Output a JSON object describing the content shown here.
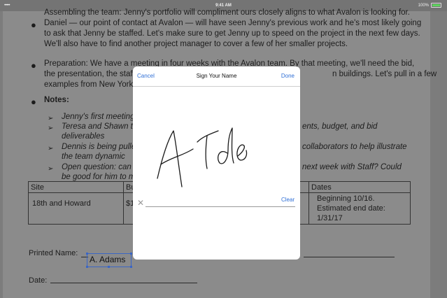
{
  "status_bar": {
    "signal": "•••••",
    "time": "9:41 AM",
    "battery": "100%"
  },
  "document": {
    "paragraph1": [
      "Assembling the team: Jenny's portfolio will compliment ours closely aligns to what Avalon is looking for.",
      "Daniel — our point of contact at Avalon — will have seen Jenny's previous work and he's most likely going",
      "to ask that Jenny be staffed. Let's make sure to get Jenny up to speed on the project in the next few days.",
      "We'll also have to find another project manager to cover a few of her smaller projects."
    ],
    "paragraph2": [
      "Preparation: We have a meeting in four weeks with the Avalon team. By that meeting, we'll need the bid,",
      "the presentation, the staff",
      "n buildings. Let's pull in a few",
      "examples from New York c"
    ],
    "notes_heading": "Notes:",
    "notes": [
      {
        "left": "Jenny's first meeting",
        "right": ""
      },
      {
        "left": "Teresa and Shawn to",
        "right": "ents, budget, and bid"
      },
      {
        "left": "deliverables",
        "right": ""
      },
      {
        "left": "Dennis is being pulled",
        "right": "collaborators to help illustrate"
      },
      {
        "left": "the team dynamic",
        "right": ""
      },
      {
        "left": "Open question: can w",
        "right": "next week with Staff? Could"
      },
      {
        "left": "be good for him to m",
        "right": ""
      }
    ],
    "table": {
      "headers": [
        "Site",
        "Bu",
        "Dates"
      ],
      "row": {
        "site": "18th and Howard",
        "budget": "$1",
        "dates": [
          "Beginning 10/16.",
          "Estimated end date:",
          "1/31/17"
        ]
      }
    },
    "printed_name_label": "Printed Name:",
    "printed_name_value": "A. Adams",
    "date_label": "Date:"
  },
  "modal": {
    "cancel": "Cancel",
    "title": "Sign Your Name",
    "done": "Done",
    "clear": "Clear",
    "x_mark": "✕"
  }
}
